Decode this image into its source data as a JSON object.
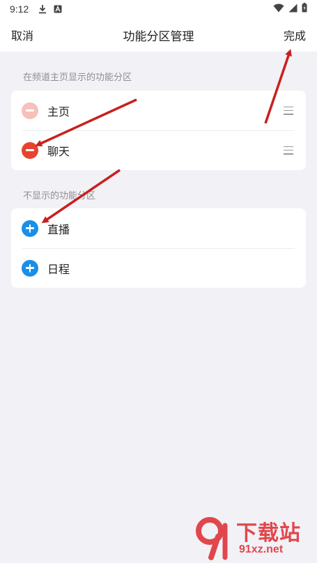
{
  "status_bar": {
    "time": "9:12",
    "icons_left": [
      "download-icon",
      "a-icon"
    ],
    "icons_right": [
      "wifi-icon",
      "signal-icon",
      "battery-icon"
    ]
  },
  "nav": {
    "cancel_label": "取消",
    "title": "功能分区管理",
    "done_label": "完成"
  },
  "shown_section": {
    "label": "在频道主页显示的功能分区",
    "items": [
      {
        "label": "主页",
        "state": "remove-disabled"
      },
      {
        "label": "聊天",
        "state": "remove"
      }
    ]
  },
  "hidden_section": {
    "label": "不显示的功能分区",
    "items": [
      {
        "label": "直播",
        "state": "add"
      },
      {
        "label": "日程",
        "state": "add"
      }
    ]
  },
  "colors": {
    "background": "#f2f1f6",
    "remove_active": "#e8432f",
    "remove_disabled": "#f6c1bb",
    "add": "#1a8fe8",
    "annotation_arrow": "#c8201e"
  },
  "watermark": {
    "title": "下载站",
    "url": "91xz.net"
  }
}
